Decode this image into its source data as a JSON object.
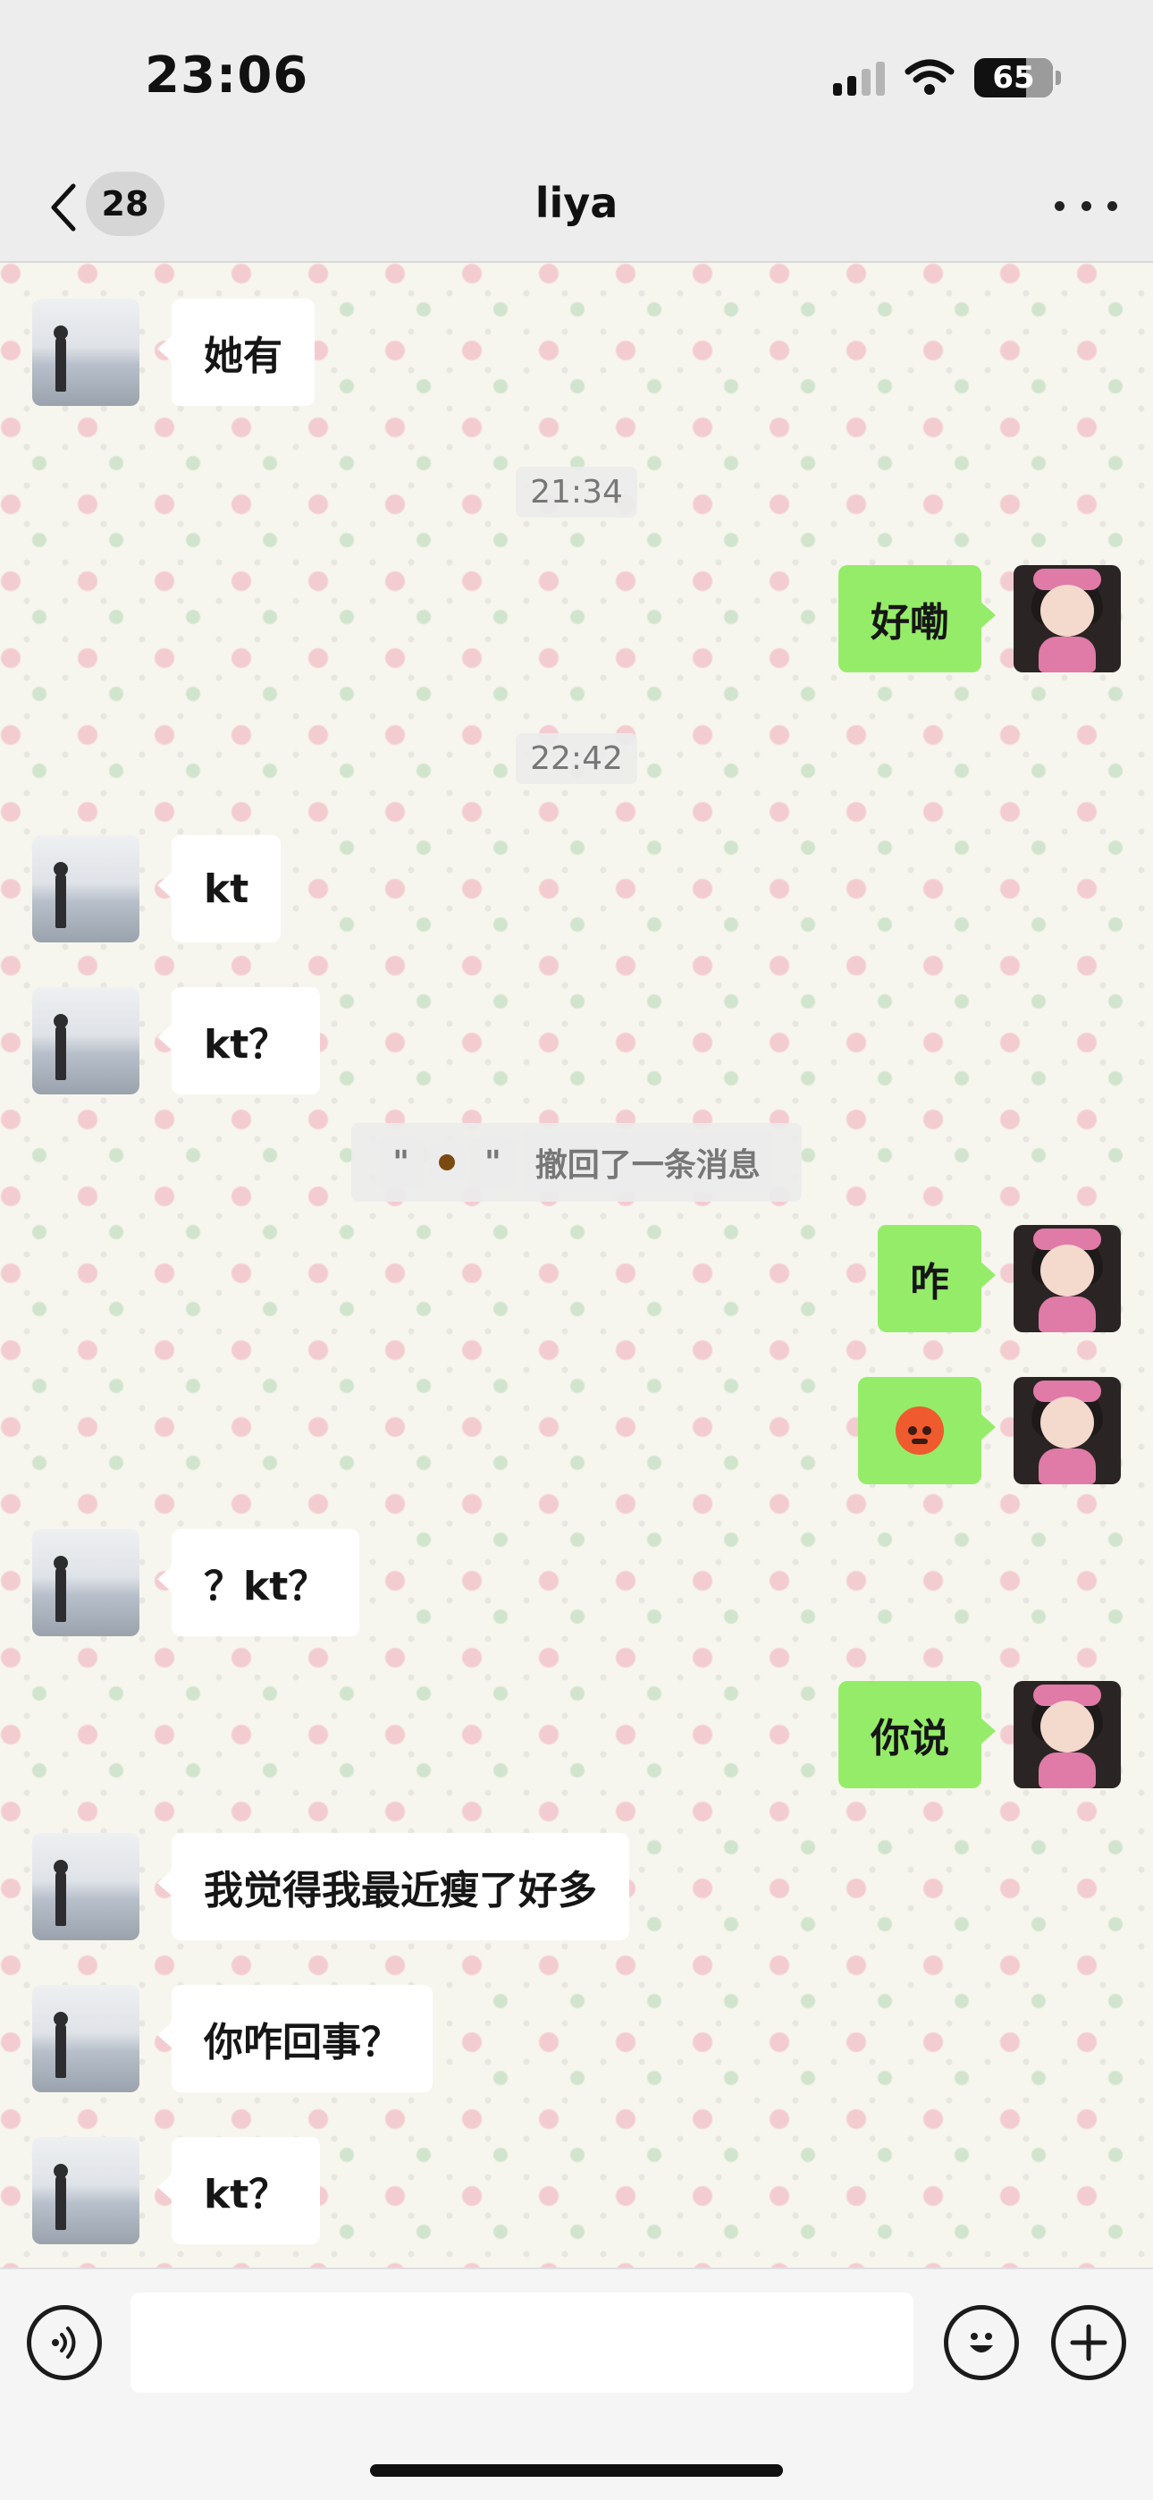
{
  "status_bar": {
    "time": "23:06",
    "battery": "65"
  },
  "nav": {
    "unread_count": "28",
    "title": "liya"
  },
  "messages": [
    {
      "text": "她有"
    },
    {
      "timestamp": "21:34"
    },
    {
      "text": "好嘞"
    },
    {
      "timestamp": "22:42"
    },
    {
      "text": "kt"
    },
    {
      "text": "kt？"
    },
    {
      "recall_text": "撤回了一条消息",
      "recall_quote_open": "\"",
      "recall_quote_close": "\""
    },
    {
      "text": "咋"
    },
    {
      "emoji": "angry-face"
    },
    {
      "text": "？kt？"
    },
    {
      "text": "你说"
    },
    {
      "text": "我觉得我最近瘦了好多"
    },
    {
      "text": "你咋回事？"
    },
    {
      "text": "kt？"
    }
  ],
  "input": {
    "value": "",
    "placeholder": ""
  },
  "colors": {
    "outgoing_bubble": "#95ec69",
    "incoming_bubble": "#ffffff",
    "bar_bg": "#ededed"
  }
}
